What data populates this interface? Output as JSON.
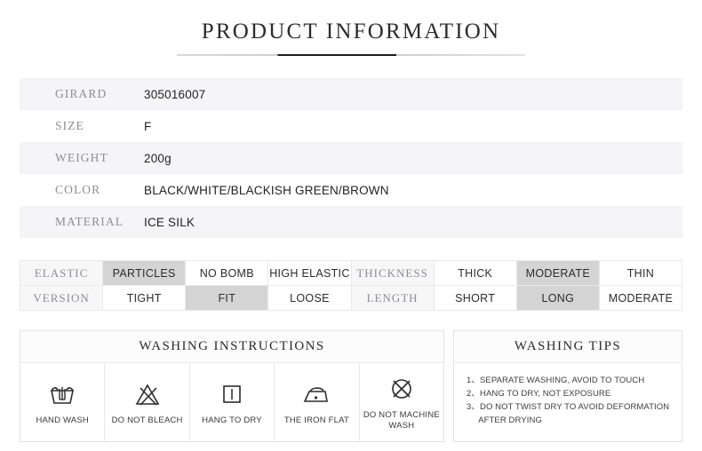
{
  "header": {
    "title": "PRODUCT INFORMATION"
  },
  "spec_table": {
    "rows": [
      {
        "label": "GIRARD",
        "value": "305016007"
      },
      {
        "label": "SIZE",
        "value": "F"
      },
      {
        "label": "WEIGHT",
        "value": "200g"
      },
      {
        "label": "COLOR",
        "value": "BLACK/WHITE/BLACKISH GREEN/BROWN"
      },
      {
        "label": "MATERIAL",
        "value": "ICE SILK"
      }
    ]
  },
  "attributes": {
    "row1": [
      {
        "text": "ELASTIC",
        "type": "head",
        "selected": false
      },
      {
        "text": "PARTICLES",
        "type": "option",
        "selected": true
      },
      {
        "text": "NO BOMB",
        "type": "option",
        "selected": false
      },
      {
        "text": "HIGH ELASTIC",
        "type": "option",
        "selected": false
      },
      {
        "text": "THICKNESS",
        "type": "head",
        "selected": false
      },
      {
        "text": "THICK",
        "type": "option",
        "selected": false
      },
      {
        "text": "MODERATE",
        "type": "option",
        "selected": true
      },
      {
        "text": "THIN",
        "type": "option",
        "selected": false
      }
    ],
    "row2": [
      {
        "text": "VERSION",
        "type": "head",
        "selected": false
      },
      {
        "text": "TIGHT",
        "type": "option",
        "selected": false
      },
      {
        "text": "FIT",
        "type": "option",
        "selected": true
      },
      {
        "text": "LOOSE",
        "type": "option",
        "selected": false
      },
      {
        "text": "LENGTH",
        "type": "head",
        "selected": false
      },
      {
        "text": "SHORT",
        "type": "option",
        "selected": false
      },
      {
        "text": "LONG",
        "type": "option",
        "selected": true
      },
      {
        "text": "MODERATE",
        "type": "option",
        "selected": false
      }
    ]
  },
  "washing_instructions": {
    "title": "WASHING INSTRUCTIONS",
    "items": [
      {
        "icon": "hand-wash-icon",
        "label": "HAND WASH"
      },
      {
        "icon": "do-not-bleach-icon",
        "label": "DO NOT BLEACH"
      },
      {
        "icon": "hang-to-dry-icon",
        "label": "HANG TO DRY"
      },
      {
        "icon": "iron-flat-icon",
        "label": "THE IRON FLAT"
      },
      {
        "icon": "do-not-machine-wash-icon",
        "label": "DO NOT MACHINE WASH"
      }
    ]
  },
  "washing_tips": {
    "title": "WASHING TIPS",
    "lines": [
      "1、SEPARATE WASHING, AVOID TO TOUCH",
      "2、HANG TO DRY, NOT EXPOSURE",
      "3、DO NOT TWIST DRY TO AVOID DEFORMATION",
      "     AFTER DRYING"
    ]
  },
  "colors": {
    "selected_cell": "#d4d4d4",
    "shaded_row": "#f5f5f7",
    "label_text": "#8d8d93",
    "value_text": "#222222",
    "border": "#e3e3e3"
  }
}
